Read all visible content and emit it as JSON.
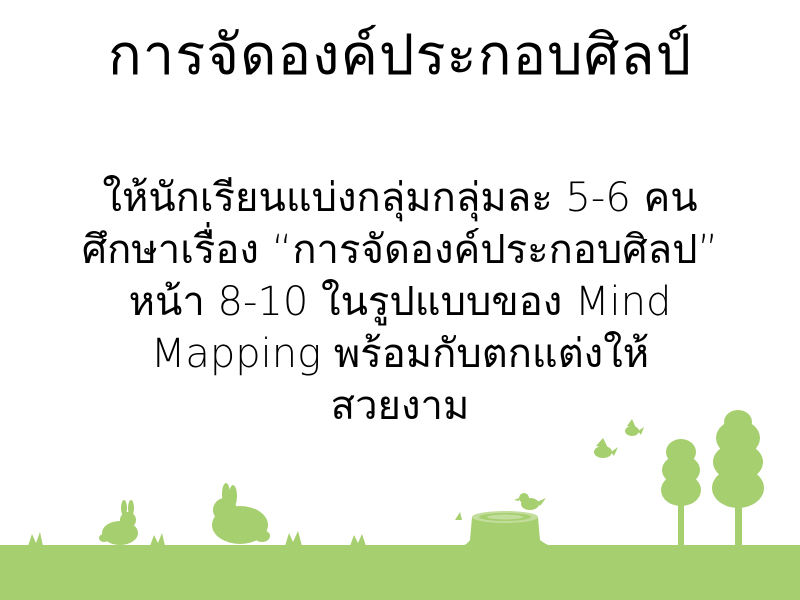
{
  "slide": {
    "title": "การจัดองค์ประกอบศิลป์",
    "body_lines": [
      "ให้นักเรียนแบ่งกลุ่มกลุ่มละ 5-6 คน",
      "ศึกษาเรื่อง “การจัดองค์ประกอบศิลป”",
      "หน้า 8-10 ในรูปแบบของ Mind",
      "Mapping พร้อมกับตกแต่งให้",
      "สวยงาม"
    ]
  },
  "colors": {
    "text": "#000000",
    "background": "#ffffff",
    "grass": "#a6cf6f",
    "silhouette": "#a6cf6f"
  },
  "decorations": [
    "grass-strip",
    "rabbit-silhouette",
    "tree-stump",
    "bird",
    "tree"
  ]
}
